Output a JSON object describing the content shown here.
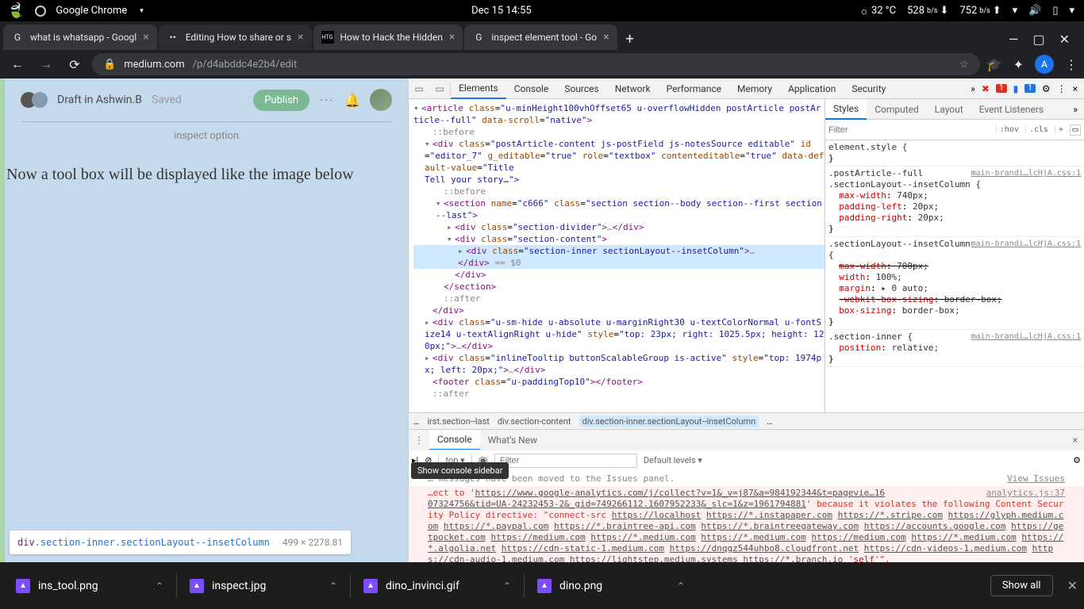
{
  "system_bar": {
    "app": "Google Chrome",
    "datetime": "Dec 15   14:55",
    "temp": "32 °C",
    "down": "528",
    "down_unit": "b/s",
    "up": "752",
    "up_unit": "b/s"
  },
  "tabs": [
    {
      "fav": "G",
      "title": "what is whatsapp - Googl"
    },
    {
      "fav": "••",
      "title": "Editing How to share or s",
      "active": true
    },
    {
      "fav": "HTG",
      "title": "How to Hack the Hidden "
    },
    {
      "fav": "G",
      "title": "inspect element tool - Go"
    }
  ],
  "url": {
    "host": "medium.com",
    "path": "/p/d4abddc4e2b4/edit"
  },
  "avatar_letter": "A",
  "editor": {
    "draft": "Draft in Ashwin.B",
    "status": "Saved",
    "publish": "Publish",
    "caption": "inspect option",
    "body_text": "Now a tool box will be displayed like the image below"
  },
  "hover_chip": {
    "tag": "div",
    "cls": ".section-inner.sectionLayout--insetColumn",
    "dim": "499 × 2278.81"
  },
  "devtools": {
    "tabs": [
      "Elements",
      "Console",
      "Sources",
      "Network",
      "Performance",
      "Memory",
      "Application",
      "Security"
    ],
    "active_tab": "Elements",
    "errors": "1",
    "infos": "1",
    "styles_tabs": [
      "Styles",
      "Computed",
      "Layout",
      "Event Listeners"
    ],
    "active_styles_tab": "Styles",
    "filter_placeholder": "Filter",
    "hov": ":hov",
    "cls": ".cls",
    "element_style": "element.style {",
    "rule1_sel": ".postArticle--full .sectionLayout--insetColumn {",
    "rule1_src": "main-brandi…lcHjA.css:1",
    "rule1_p1": "max-width",
    "rule1_v1": "740px;",
    "rule1_p2": "padding-left",
    "rule1_v2": "20px;",
    "rule1_p3": "padding-right",
    "rule1_v3": "20px;",
    "rule2_sel": ".sectionLayout--insetColumn {",
    "rule2_src": "main-brandi…lcHjA.css:1",
    "rule2_p1": "max-width",
    "rule2_v1": "700px;",
    "rule2_p2": "width",
    "rule2_v2": "100%;",
    "rule2_p3": "margin",
    "rule2_v3": "▸ 0 auto;",
    "rule2_p4": "-webkit-box-sizing",
    "rule2_v4": "border-box;",
    "rule2_p5": "box-sizing",
    "rule2_v5": "border-box;",
    "rule3_sel": ".section-inner {",
    "rule3_src": "main-brandi…lcHjA.css:1",
    "rule3_p1": "position",
    "rule3_v1": "relative;",
    "crumbs_pre": "…",
    "crumb1": "irst.section--last",
    "crumb2": "div.section-content",
    "crumb3": "div.section-inner.sectionLayout--insetColumn",
    "crumbs_post": "…"
  },
  "dom": {
    "l1": "<article class=\"u-minHeight100vhOffset65 u-overflowHidden postArticle postArticle--full\" data-scroll=\"native\">",
    "l2": "::before",
    "l3": "<div class=\"postArticle-content js-postField js-notesSource editable\" id=\"editor_7\" g_editable=\"true\" role=\"textbox\" contenteditable=\"true\" data-default-value=\"Title",
    "l3b": "Tell your story…\">",
    "l4": "::before",
    "l5": "<section name=\"c666\" class=\"section section--body section--first section--last\">",
    "l6": "<div class=\"section-divider\">…</div>",
    "l7": "<div class=\"section-content\">",
    "l8": "<div class=\"section-inner sectionLayout--insetColumn\">…</div>",
    "l8b": " == $0",
    "l9": "</div>",
    "l10": "</section>",
    "l11": "::after",
    "l12": "</div>",
    "l13": "<div class=\"u-sm-hide u-absolute u-marginRight30 u-textColorNormal u-fontSize14 u-textAlignRight u-hide\" style=\"top: 23px; right: 1025.5px; height: 120px;\">…</div>",
    "l14": "<div class=\"inlineTooltip buttonScalableGroup is-active\" style=\"top: 1974px; left: 20px;\">…</div>",
    "l15": "<footer class=\"u-paddingTop10\"></footer>",
    "l16": "::after"
  },
  "console": {
    "tabs": [
      "Console",
      "What's New"
    ],
    "active": "Console",
    "context": "top",
    "filter_placeholder": "Filter",
    "levels": "Default levels",
    "tooltip": "Show console sidebar",
    "issue_msg": "… messages have been moved to the Issues panel.",
    "issue_link": "View Issues",
    "err_src": "analytics.js:37",
    "err_pre": "…ect to '",
    "err_url1": "https://www.google-analytics.com/j/collect?v=1&_v=j87&a=984192344&t=pagevie…16",
    "err_mid": "07324756&tid=UA-24232453-2&_gid=749266112.1607952233&_slc=1&z=1961794881",
    "err_post": "' because it violates the following Content Security Policy directive: \"connect-src ",
    "urls": [
      "https://localhost",
      "https://*.instapaper.com",
      "https://*.stripe.com",
      "https://glyph.medium.com",
      "https://*.paypal.com",
      "https://*.braintree-api.com",
      "https://*.braintreegateway.com",
      "https://accounts.google.com",
      "https://getpocket.com",
      "https://medium.com",
      "https://*.medium.com",
      "https://*.medium.com",
      "https://medium.com",
      "https://*.medium.com",
      "https://*.algolia.net",
      "https://cdn-static-1.medium.com",
      "https://dnqgz544uhbo8.cloudfront.net",
      "https://cdn-videos-1.medium.com",
      "https://cdn-audio-1.medium.com",
      "https://lightstep.medium.systems",
      "https://*.branch.io"
    ],
    "self_end": " 'self'\"."
  },
  "taskbar": {
    "files": [
      "ins_tool.png",
      "inspect.jpg",
      "dino_invinci.gif",
      "dino.png"
    ],
    "showall": "Show all"
  }
}
